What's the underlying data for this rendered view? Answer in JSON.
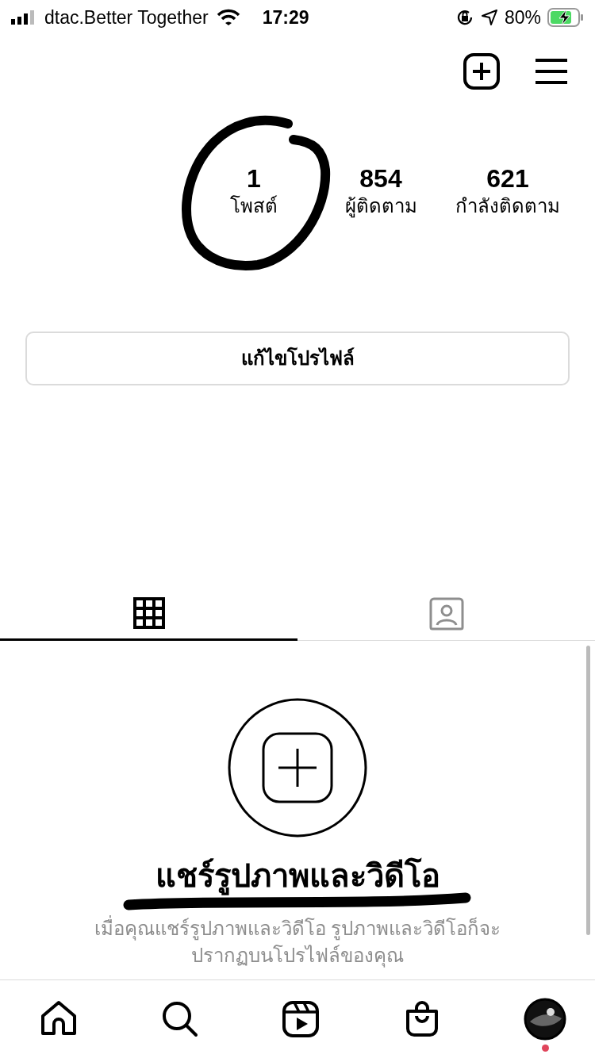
{
  "status_bar": {
    "carrier": "dtac.Better Together",
    "time": "17:29",
    "battery": "80%"
  },
  "stats": [
    {
      "value": "1",
      "label": "โพสต์",
      "circled": true
    },
    {
      "value": "854",
      "label": "ผู้ติดตาม",
      "circled": false
    },
    {
      "value": "621",
      "label": "กำลังติดตาม",
      "circled": false
    }
  ],
  "edit_profile_button": "แก้ไขโปรไฟล์",
  "tabs": [
    {
      "kind": "grid",
      "selected": true
    },
    {
      "kind": "tagged",
      "selected": false
    }
  ],
  "empty_state": {
    "title": "แชร์รูปภาพและวิดีโอ",
    "description": [
      "เมื่อคุณแชร์รูปภาพและวิดีโอ รูปภาพและวิดีโอก็จะ",
      "ปรากฏบนโปรไฟล์ของคุณ"
    ]
  },
  "bottom_nav": [
    {
      "kind": "home",
      "notification": false
    },
    {
      "kind": "search",
      "notification": false
    },
    {
      "kind": "reels",
      "notification": false
    },
    {
      "kind": "shop",
      "notification": false
    },
    {
      "kind": "profile",
      "notification": true
    }
  ]
}
